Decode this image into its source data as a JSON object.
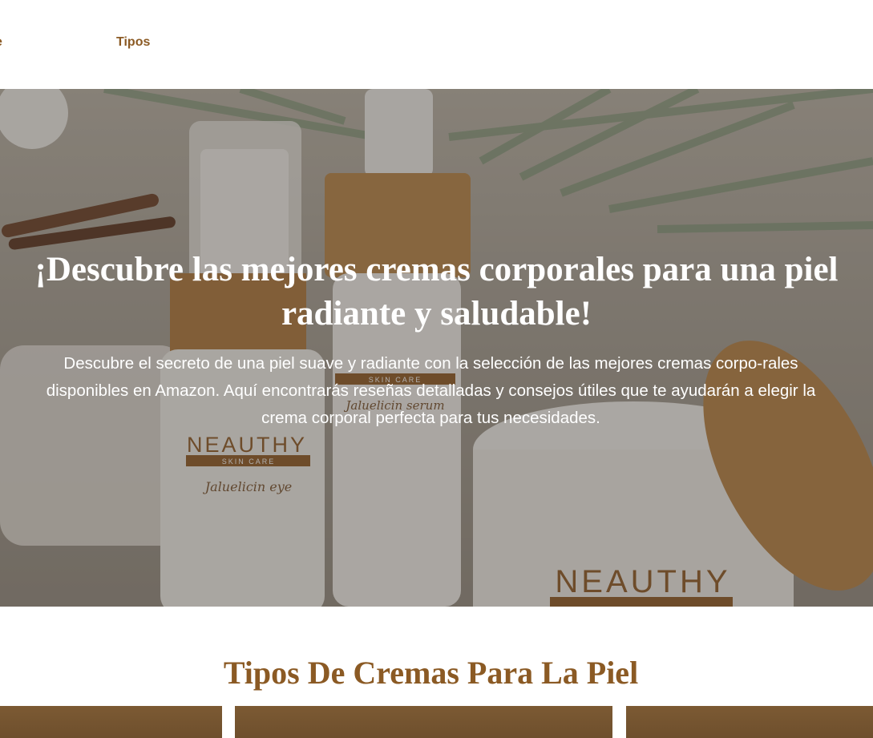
{
  "header": {
    "nav": [
      {
        "label": "e"
      },
      {
        "label": "Tipos"
      }
    ]
  },
  "hero": {
    "title": "¡Descubre las mejores cremas corporales para una piel radiante y saludable!",
    "description": "Descubre el secreto de una piel suave y radiante con la selección de las mejores cremas corpo-rales disponibles en Amazon. Aquí encontrarás reseñas detalladas y consejos útiles que te ayudarán a elegir la crema corporal perfecta para tus necesidades.",
    "image_text": {
      "brand": "NEAUTHY",
      "tagline": "SKIN CARE",
      "product_eye": "Jaluelicin eye",
      "product_serum": "Jaluelicin serum"
    }
  },
  "section": {
    "title": "Tipos De Cremas Para La Piel",
    "cards": [
      {
        "id": "card-1"
      },
      {
        "id": "card-2"
      },
      {
        "id": "card-3"
      }
    ]
  },
  "colors": {
    "accent": "#8b5a24",
    "card": "#75552f",
    "hero_text": "#ffffff"
  }
}
